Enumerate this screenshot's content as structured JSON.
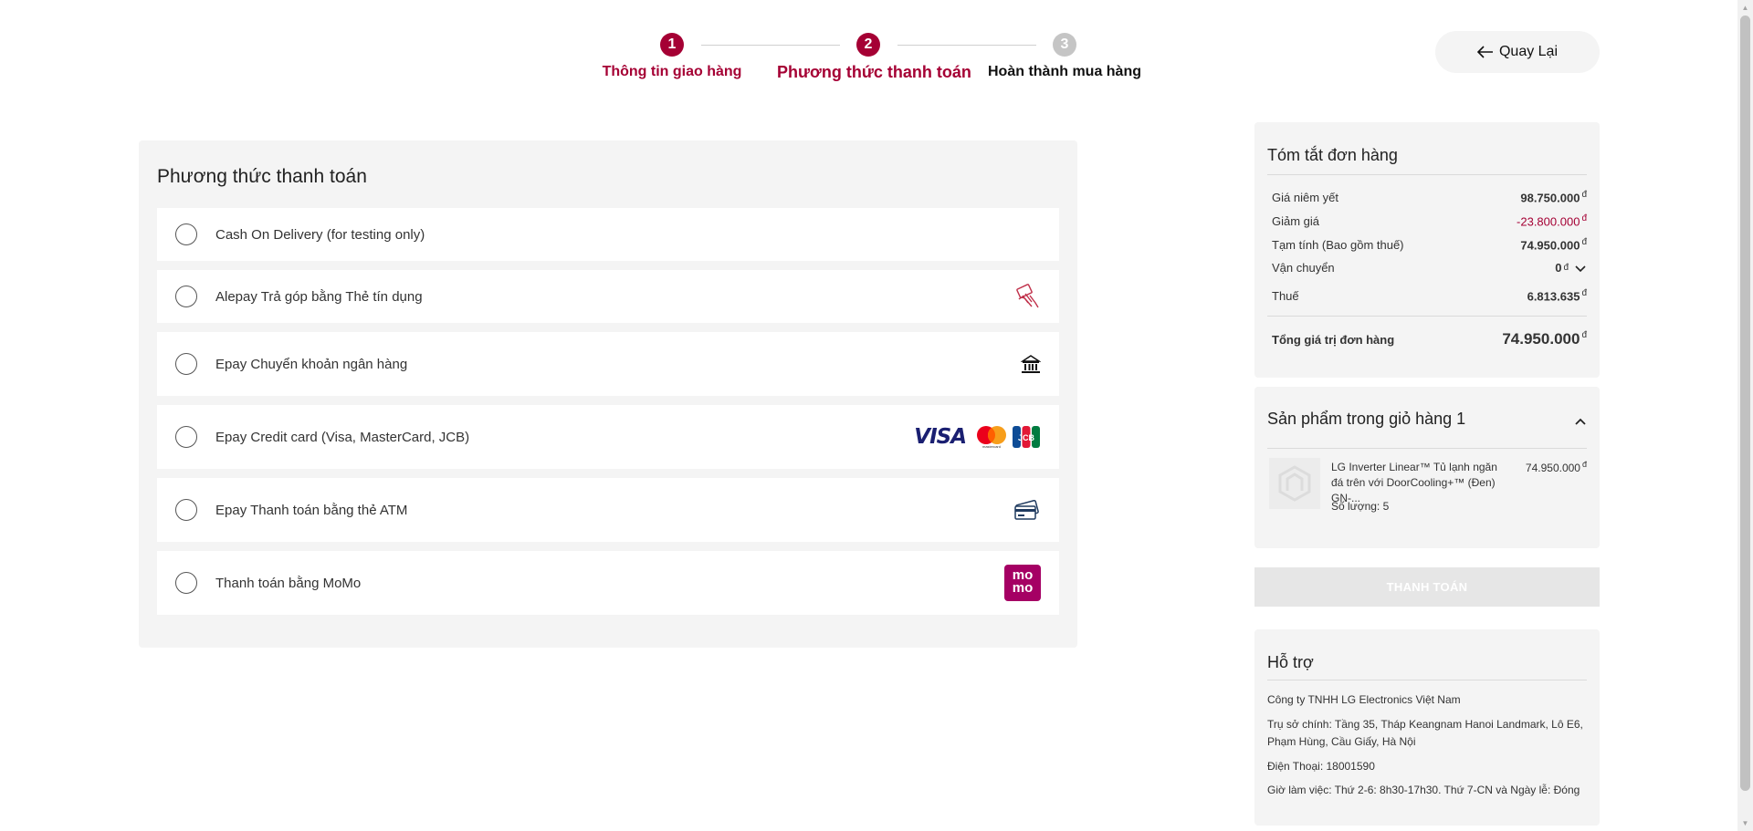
{
  "stepper": {
    "steps": [
      {
        "num": "1",
        "label": "Thông tin giao hàng"
      },
      {
        "num": "2",
        "label": "Phương thức thanh toán"
      },
      {
        "num": "3",
        "label": "Hoàn thành mua hàng"
      }
    ],
    "active_color": "#a50034",
    "inactive_color": "#c5c5c5"
  },
  "back_button": {
    "label": "Quay Lại",
    "icon": "arrow-left-icon"
  },
  "payment": {
    "title": "Phương thức thanh toán",
    "options": [
      {
        "label": "Cash On Delivery (for testing only)",
        "icon": ""
      },
      {
        "label": "Alepay Trả góp bằng Thẻ tín dụng",
        "icon": "hand-card-icon"
      },
      {
        "label": "Epay Chuyển khoản ngân hàng",
        "icon": "bank-icon"
      },
      {
        "label": "Epay Credit card (Visa, MasterCard, JCB)",
        "icon": "card-brands-icon",
        "brands": [
          "VISA",
          "mastercard",
          "JCB"
        ]
      },
      {
        "label": "Epay Thanh toán bằng thẻ ATM",
        "icon": "atm-card-icon"
      },
      {
        "label": "Thanh toán bằng MoMo",
        "icon": "momo-icon",
        "icon_text_top": "mo",
        "icon_text_bottom": "mo",
        "icon_color": "#a50064"
      }
    ]
  },
  "summary": {
    "title": "Tóm tắt đơn hàng",
    "rows": [
      {
        "key": "Giá niêm yết",
        "value": "98.750.000",
        "currency": "đ"
      },
      {
        "key": "Giảm giá",
        "value": "-23.800.000",
        "currency": "đ"
      },
      {
        "key": "Tạm tính (Bao gồm thuế)",
        "value": "74.950.000",
        "currency": "đ"
      },
      {
        "key": "Vận chuyển",
        "value": "0",
        "currency": "đ"
      },
      {
        "key": "Thuế",
        "value": "6.813.635",
        "currency": "đ"
      }
    ],
    "total": {
      "key": "Tổng giá trị đơn hàng",
      "value": "74.950.000",
      "currency": "đ"
    }
  },
  "cart": {
    "title": "Sản phẩm trong giỏ hàng 1",
    "item": {
      "name": "LG Inverter Linear™ Tủ lạnh ngăn đá trên với DoorCooling+™ (Đen) GN-...",
      "price": "74.950.000",
      "currency": "đ",
      "qty": "Số lượng: 5"
    }
  },
  "pay_button": {
    "label": "THANH TOÁN"
  },
  "support": {
    "title": "Hỗ trợ",
    "company": "Công ty TNHH LG Electronics Việt Nam",
    "address": "Trụ sở chính: Tầng 35, Tháp Keangnam Hanoi Landmark, Lô E6, Phạm Hùng, Cầu Giấy, Hà Nội",
    "phone": "Điện Thoại: 18001590",
    "hours": "Giờ làm việc: Thứ 2-6: 8h30-17h30. Thứ 7-CN và Ngày lễ: Đóng"
  }
}
